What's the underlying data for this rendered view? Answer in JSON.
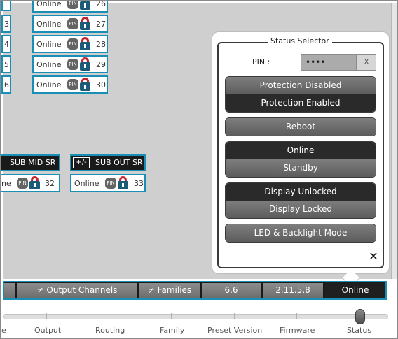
{
  "channels": [
    {
      "status": "Online",
      "pin": "PIN",
      "number": "26"
    },
    {
      "status": "Online",
      "pin": "PIN",
      "number": "27"
    },
    {
      "status": "Online",
      "pin": "PIN",
      "number": "28"
    },
    {
      "status": "Online",
      "pin": "PIN",
      "number": "29"
    },
    {
      "status": "Online",
      "pin": "PIN",
      "number": "30"
    }
  ],
  "left_partial_numbers": [
    "3",
    "4",
    "5",
    "6"
  ],
  "sub_mid": {
    "title": "SUB MID SR",
    "status_partial": "ne",
    "pin": "PIN",
    "number": "32"
  },
  "sub_out": {
    "plusminus": "+/-",
    "title": "SUB OUT SR",
    "status": "Online",
    "pin": "PIN",
    "number": "33"
  },
  "status_selector": {
    "title": "Status Selector",
    "pin_label": "PIN :",
    "pin_value": "••••",
    "pin_clear": "X",
    "protection_disabled": "Protection Disabled",
    "protection_enabled": "Protection Enabled",
    "reboot": "Reboot",
    "online": "Online",
    "standby": "Standby",
    "display_unlocked": "Display Unlocked",
    "display_locked": "Display Locked",
    "led_backlight": "LED & Backlight Mode",
    "close": "✕"
  },
  "tabs": [
    {
      "label": ""
    },
    {
      "label": "≠ Output Channels"
    },
    {
      "label": "≠ Families"
    },
    {
      "label": "6.6"
    },
    {
      "label": "2.11.5.8"
    },
    {
      "label": "Online"
    }
  ],
  "slider": {
    "labels": [
      "e",
      "Output",
      "Routing",
      "Family",
      "Preset Version",
      "Firmware",
      "Status"
    ],
    "selected": "Status"
  },
  "colors": {
    "accent": "#1a8fb5",
    "lock_red": "#c4242d",
    "lock_blue": "#1c5b78",
    "dark": "#1a1a1a"
  },
  "icons": {
    "pin": "pin-badge-icon",
    "lock": "padlock-icon",
    "close": "close-icon"
  }
}
